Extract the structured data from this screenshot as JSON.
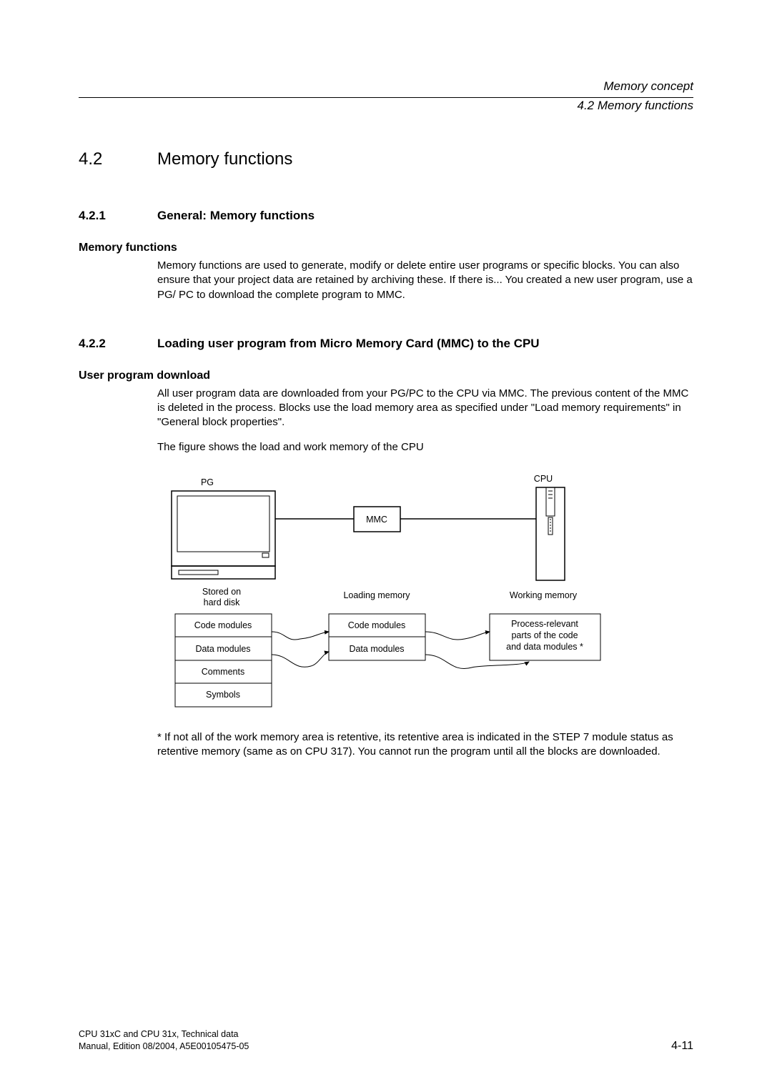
{
  "header": {
    "chapter": "Memory concept",
    "section": "4.2 Memory functions"
  },
  "sec42": {
    "num": "4.2",
    "title": "Memory functions"
  },
  "sec421": {
    "num": "4.2.1",
    "title": "General: Memory functions",
    "paraTitle": "Memory functions",
    "body": "Memory functions are used to generate, modify or delete entire user programs or specific blocks. You can also ensure that your project data are retained by archiving these. If there is... You created a new user program, use a PG/ PC to download the complete program to MMC."
  },
  "sec422": {
    "num": "4.2.2",
    "title": "Loading user program from Micro Memory Card (MMC) to the CPU",
    "paraTitle": "User program download",
    "body1": "All user program data are downloaded from your PG/PC to the CPU via MMC. The previous content of the MMC is deleted in the process. Blocks use the load memory area as specified under \"Load memory requirements\" in \"General block properties\".",
    "body2": "The figure shows the load and work memory of the CPU",
    "footnote": "* If not all of the work memory area is retentive, its retentive area is indicated in the STEP 7 module status as retentive memory (same as on CPU 317). You cannot run the program until all the blocks are downloaded."
  },
  "diagram": {
    "pg": "PG",
    "cpu": "CPU",
    "mmc": "MMC",
    "stored1": "Stored on",
    "stored2": "hard disk",
    "loading": "Loading memory",
    "working": "Working memory",
    "codeModules": "Code modules",
    "dataModules": "Data modules",
    "comments": "Comments",
    "symbols": "Symbols",
    "process1": "Process-relevant",
    "process2": "parts of the code",
    "process3": "and data modules *"
  },
  "footer": {
    "line1": "CPU 31xC and CPU 31x, Technical data",
    "line2": "Manual, Edition 08/2004, A5E00105475-05",
    "pageNum": "4-11"
  }
}
